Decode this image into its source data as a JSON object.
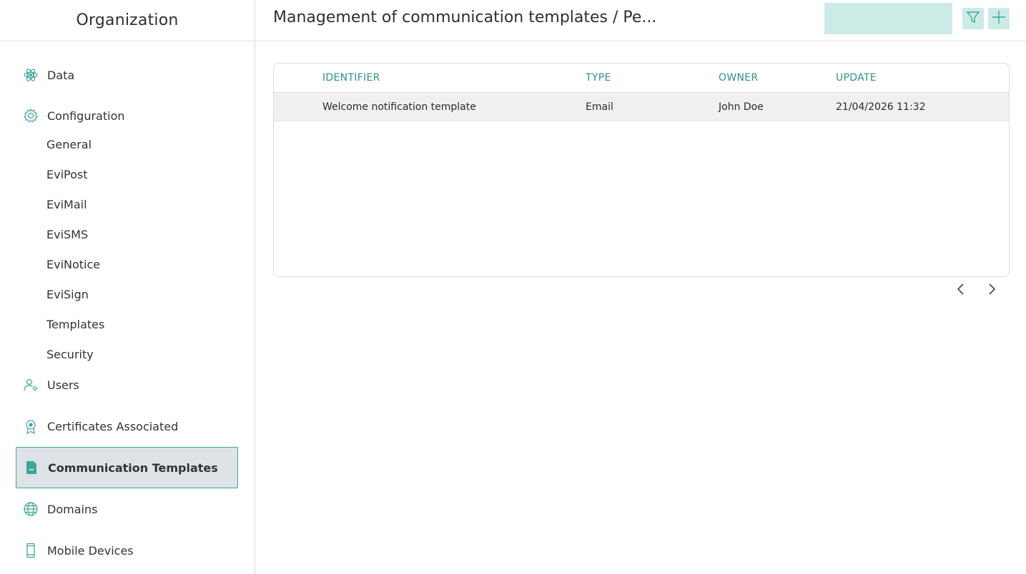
{
  "sidebar": {
    "title": "Organization",
    "items": [
      {
        "label": "Data",
        "icon": "atom-icon"
      },
      {
        "label": "Configuration",
        "icon": "gear-icon"
      },
      {
        "label": "Users",
        "icon": "user-settings-icon"
      },
      {
        "label": "Certificates Associated",
        "icon": "certificate-icon"
      },
      {
        "label": "Communication Templates",
        "icon": "document-icon"
      },
      {
        "label": "Domains",
        "icon": "globe-icon"
      },
      {
        "label": "Mobile Devices",
        "icon": "mobile-icon"
      }
    ],
    "config_subitems": [
      "General",
      "EviPost",
      "EviMail",
      "EviSMS",
      "EviNotice",
      "EviSign",
      "Templates",
      "Security"
    ]
  },
  "header": {
    "title": "Management of communication templates / Pe...",
    "search_placeholder": ""
  },
  "table": {
    "columns": [
      "IDENTIFIER",
      "TYPE",
      "OWNER",
      "UPDATE"
    ],
    "rows": [
      {
        "identifier": "Welcome notification template",
        "type": "Email",
        "owner": "John Doe",
        "update": "21/04/2026 11:32"
      }
    ]
  },
  "colors": {
    "accent": "#2c9484",
    "button_bg": "#cdebe6",
    "active_bg": "#dde3e6"
  }
}
